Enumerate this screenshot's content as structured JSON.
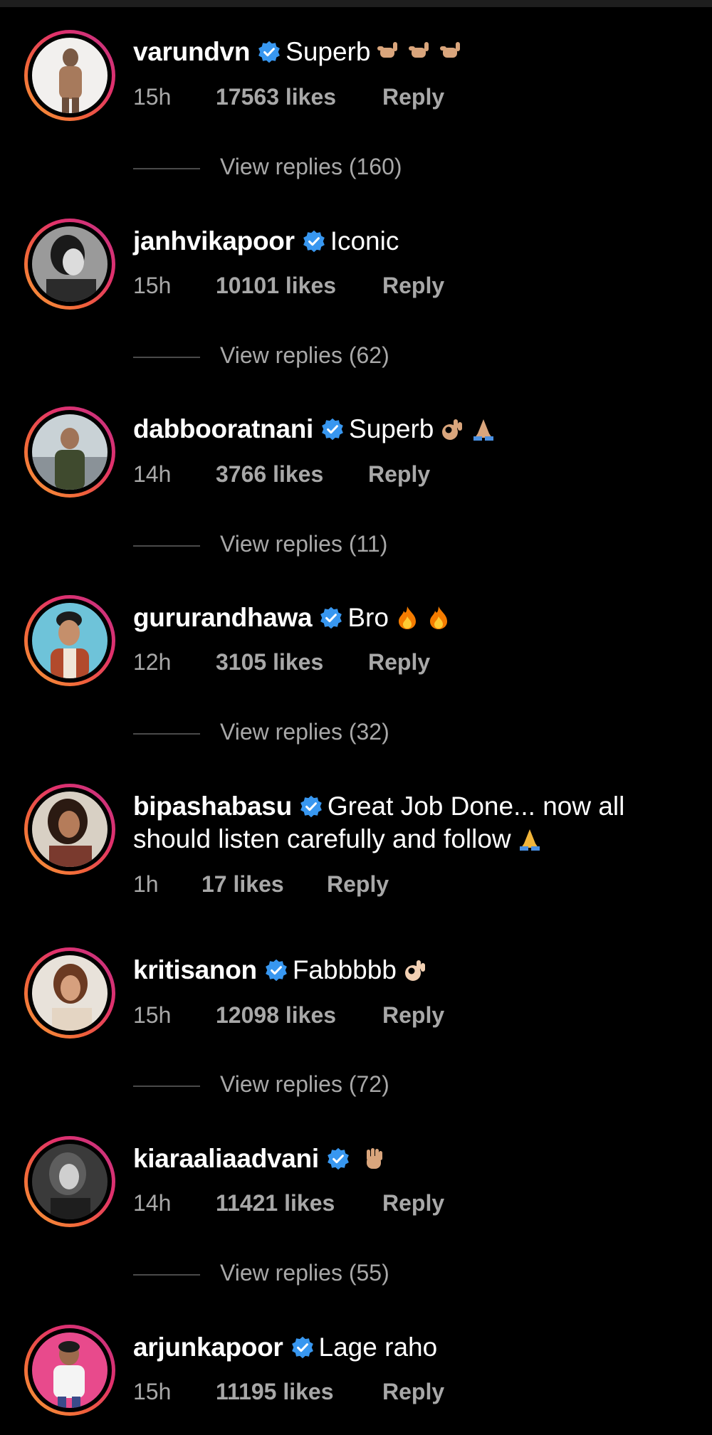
{
  "comments": [
    {
      "username": "varundvn",
      "text": "Superb",
      "emojis": [
        "call-me-hand-emoji",
        "call-me-hand-emoji",
        "call-me-hand-emoji"
      ],
      "time": "15h",
      "likes": "17563 likes",
      "reply": "Reply",
      "view_replies": "View replies (160)"
    },
    {
      "username": "janhvikapoor",
      "text": "Iconic",
      "emojis": [],
      "time": "15h",
      "likes": "10101 likes",
      "reply": "Reply",
      "view_replies": "View replies (62)"
    },
    {
      "username": "dabbooratnani",
      "text": "Superb",
      "emojis": [
        "ok-hand-emoji",
        "folded-hands-emoji"
      ],
      "time": "14h",
      "likes": "3766 likes",
      "reply": "Reply",
      "view_replies": "View replies (11)"
    },
    {
      "username": "gururandhawa",
      "text": "Bro",
      "emojis": [
        "fire-emoji",
        "fire-emoji"
      ],
      "time": "12h",
      "likes": "3105 likes",
      "reply": "Reply",
      "view_replies": "View replies (32)"
    },
    {
      "username": "bipashabasu",
      "text": "Great Job Done... now all should listen carefully and follow",
      "emojis": [
        "folded-hands-emoji"
      ],
      "time": "1h",
      "likes": "17 likes",
      "reply": "Reply",
      "view_replies": ""
    },
    {
      "username": "kritisanon",
      "text": "Fabbbbb",
      "emojis": [
        "ok-hand-emoji"
      ],
      "time": "15h",
      "likes": "12098 likes",
      "reply": "Reply",
      "view_replies": "View replies (72)"
    },
    {
      "username": "kiaraaliaadvani",
      "text": "",
      "emojis": [
        "waving-hand-emoji"
      ],
      "time": "14h",
      "likes": "11421 likes",
      "reply": "Reply",
      "view_replies": "View replies (55)"
    },
    {
      "username": "arjunkapoor",
      "text": "Lage raho",
      "emojis": [],
      "time": "15h",
      "likes": "11195 likes",
      "reply": "Reply",
      "view_replies": ""
    }
  ],
  "colors": {
    "background": "#000000",
    "text": "#ffffff",
    "secondary_text": "#a8a8a8",
    "verified_badge": "#3897f0",
    "ring_gradient": [
      "#f9a13b",
      "#f0603a",
      "#e1306c",
      "#c13584"
    ]
  }
}
